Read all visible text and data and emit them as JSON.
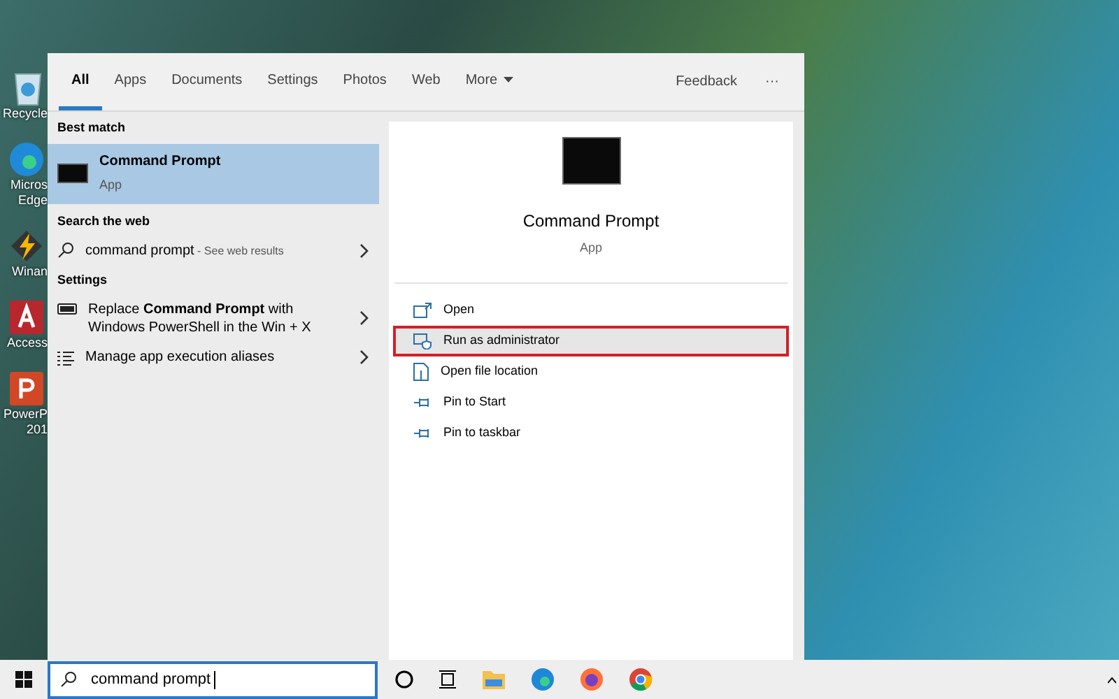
{
  "desktop_icons": [
    {
      "kind": "recycle",
      "label": "Recycle"
    },
    {
      "kind": "edge",
      "label": "Micros Edge"
    },
    {
      "kind": "winamp",
      "label": "Winan"
    },
    {
      "kind": "access",
      "label": "Access"
    },
    {
      "kind": "powerpoint",
      "label": "PowerP 201"
    }
  ],
  "tabs": [
    {
      "label": "All",
      "selected": true
    },
    {
      "label": "Apps",
      "selected": false
    },
    {
      "label": "Documents",
      "selected": false
    },
    {
      "label": "Settings",
      "selected": false
    },
    {
      "label": "Photos",
      "selected": false
    },
    {
      "label": "Web",
      "selected": false
    },
    {
      "label": "More",
      "selected": false,
      "dropdown": true
    }
  ],
  "feedback": "Feedback",
  "more_options": "···",
  "best_match": {
    "heading": "Best match",
    "title": "Command Prompt",
    "subtitle": "App",
    "selected": true
  },
  "web_section": {
    "heading": "Search the web",
    "query": "command prompt",
    "hint": " - See web results"
  },
  "settings_section": {
    "heading": "Settings",
    "items": [
      {
        "kind": "toggle",
        "text": "Replace **Command Prompt** with Windows PowerShell in the Win + X"
      },
      {
        "kind": "list",
        "text": "Manage app execution aliases"
      }
    ]
  },
  "detail": {
    "title": "Command Prompt",
    "subtitle": "App",
    "actions": [
      {
        "kind": "open",
        "label": "Open",
        "highlighted": false
      },
      {
        "kind": "admin",
        "label": "Run as administrator",
        "highlighted": true
      },
      {
        "kind": "folder",
        "label": "Open file location",
        "highlighted": false
      },
      {
        "kind": "pin",
        "label": "Pin to Start",
        "highlighted": false
      },
      {
        "kind": "pin",
        "label": "Pin to taskbar",
        "highlighted": false
      }
    ]
  },
  "search_box": {
    "value": "command prompt"
  },
  "taskbar_apps": [
    {
      "kind": "cortana"
    },
    {
      "kind": "taskview"
    },
    {
      "kind": "explorer"
    },
    {
      "kind": "edge"
    },
    {
      "kind": "firefox"
    },
    {
      "kind": "chrome"
    }
  ]
}
